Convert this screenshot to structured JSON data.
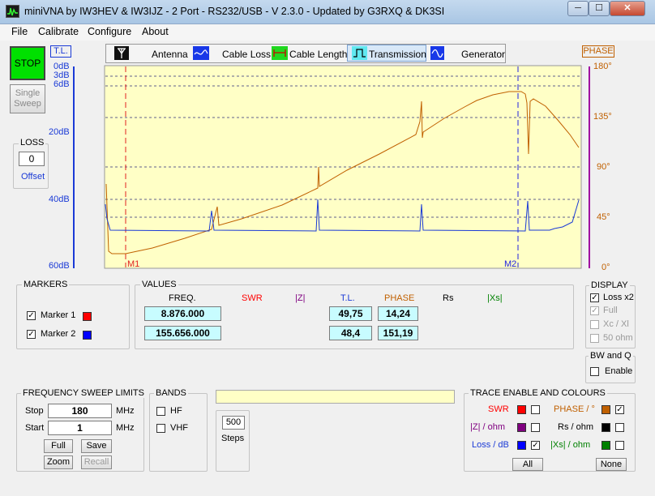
{
  "window": {
    "title": "miniVNA by IW3HEV & IW3IJZ - 2 Port - RS232/USB - V 2.3.0 - Updated by G3RXQ & DK3SI",
    "min": "─",
    "max": "☐",
    "close": "✕"
  },
  "menu": [
    "File",
    "Calibrate",
    "Configure",
    "About"
  ],
  "left": {
    "stop": "STOP",
    "single_l1": "Single",
    "single_l2": "Sweep",
    "loss_title": "LOSS",
    "loss_value": "0",
    "offset": "Offset"
  },
  "tabs": [
    "Antenna",
    "Cable Loss",
    "Cable Length",
    "Transmission",
    "Generator"
  ],
  "axis": {
    "tl": "T.L.",
    "phase": "PHASE",
    "left_ticks": [
      "0dB",
      "3dB",
      "6dB",
      "20dB",
      "40dB",
      "60dB"
    ],
    "right_ticks": [
      "180°",
      "135°",
      "90°",
      "45°",
      "0°"
    ],
    "m1": "M1",
    "m2": "M2"
  },
  "markers": {
    "title": "MARKERS",
    "m1": "Marker 1",
    "m2": "Marker 2",
    "m1_color": "#ff0000",
    "m2_color": "#0000ff"
  },
  "values": {
    "title": "VALUES",
    "headers": [
      "FREQ.",
      "SWR",
      "|Z|",
      "T.L.",
      "PHASE",
      "Rs",
      "|Xs|"
    ],
    "rows": [
      {
        "freq": "8.876.000",
        "tl": "49,75",
        "phase": "14,24"
      },
      {
        "freq": "155.656.000",
        "tl": "48,4",
        "phase": "151,19"
      }
    ]
  },
  "display": {
    "title": "DISPLAY",
    "loss_x2": "Loss x2",
    "full": "Full",
    "xcxl": "Xc / Xl",
    "ohm50": "50 ohm"
  },
  "bwq": {
    "title": "BW and Q",
    "enable": "Enable"
  },
  "sweep": {
    "title": "FREQUENCY SWEEP LIMITS",
    "stop_label": "Stop",
    "stop_value": "180",
    "start_label": "Start",
    "start_value": "1",
    "unit": "MHz",
    "full": "Full",
    "save": "Save",
    "zoom": "Zoom",
    "recall": "Recall"
  },
  "bands": {
    "title": "BANDS",
    "hf": "HF",
    "vhf": "VHF"
  },
  "steps": {
    "value": "500",
    "label": "Steps"
  },
  "trace": {
    "title": "TRACE ENABLE AND COLOURS",
    "swr": "SWR",
    "z": "|Z| / ohm",
    "loss": "Loss / dB",
    "phase": "PHASE / °",
    "rs": "Rs / ohm",
    "xs": "|Xs| / ohm",
    "all": "All",
    "none": "None",
    "colors": {
      "swr": "#ff0000",
      "z": "#800080",
      "loss": "#0000ff",
      "phase": "#c06000",
      "rs": "#000000",
      "xs": "#008000"
    }
  },
  "colors": {
    "plot_bg": "#ffffc6",
    "phase_trace": "#c06000",
    "loss_trace": "#1a3ad6",
    "marker1": "#e02020",
    "marker2": "#2020e0"
  }
}
